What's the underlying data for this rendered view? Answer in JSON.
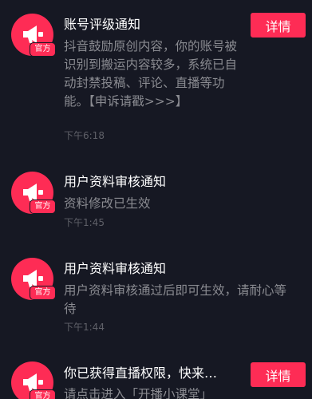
{
  "colors": {
    "background": "#161823",
    "accent": "#fe2c55",
    "title": "#ffffff",
    "body": "#8a8b91",
    "time": "#5f6068"
  },
  "notifications": [
    {
      "icon": "megaphone-icon",
      "badge": "官方",
      "title": "账号评级通知",
      "body": "抖音鼓励原创内容，你的账号被识别到搬运内容较多，系统已自动封禁投稿、评论、直播等功能。【申诉请戳>>>】",
      "time": "下午6:18",
      "button": "详情"
    },
    {
      "icon": "megaphone-icon",
      "badge": "官方",
      "title": "用户资料审核通知",
      "body": "资料修改已生效",
      "time": "下午1:45"
    },
    {
      "icon": "megaphone-icon",
      "badge": "官方",
      "title": "用户资料审核通知",
      "body": "用户资料审核通过后即可生效，请耐心等待",
      "time": "下午1:44"
    },
    {
      "icon": "megaphone-icon",
      "badge": "官方",
      "title": "你已获得直播权限，快来…",
      "body": "请点击进入「开播小课堂」",
      "time": "",
      "button": "详情"
    }
  ]
}
